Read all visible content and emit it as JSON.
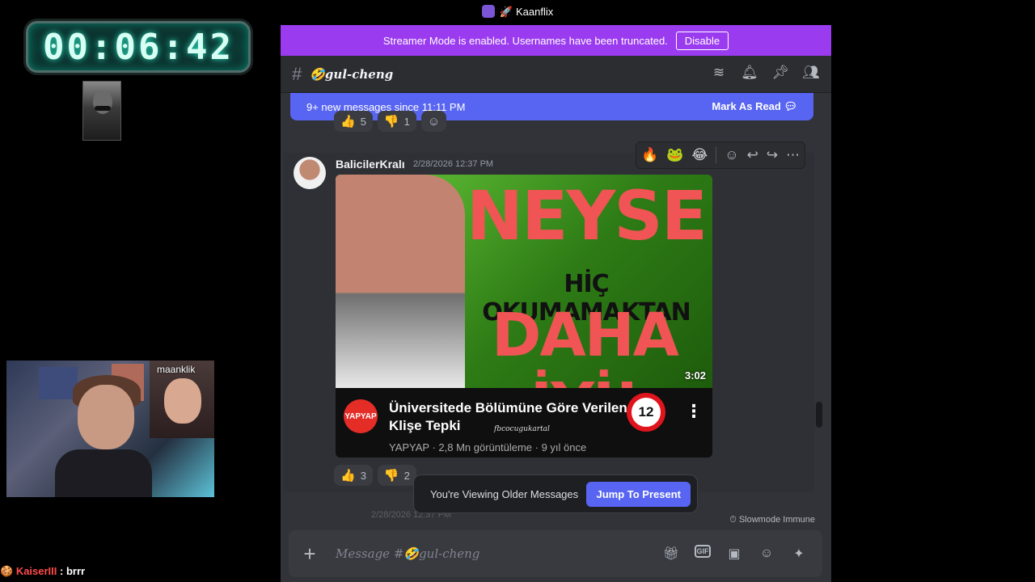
{
  "window": {
    "title": "Kaanflix"
  },
  "overlay": {
    "timer": "00:06:42",
    "webcam_name": "maanklik",
    "chat": {
      "user": "KaiserIII",
      "text": ": brrr"
    }
  },
  "streamer_bar": {
    "text": "Streamer Mode is enabled. Usernames have been truncated.",
    "button": "Disable"
  },
  "channel": {
    "name": "🤣gul-cheng"
  },
  "new_messages": {
    "text": "9+ new messages since 11:11 PM",
    "mark_read": "Mark As Read"
  },
  "prev_reactions": [
    {
      "emoji": "👍",
      "count": "5"
    },
    {
      "emoji": "👎",
      "count": "1"
    },
    {
      "emoji": "☺",
      "count": ""
    }
  ],
  "message": {
    "author": "BalicilerKralı",
    "timestamp": "2/28/2026 12:37 PM",
    "toolbar_emojis": [
      "🔥",
      "🐸",
      "😂"
    ],
    "embed": {
      "thumb_line1": "NEYSE",
      "thumb_line2": "HİÇ OKUMAMAKTAN",
      "thumb_line3": "DAHA İYİ!",
      "duration": "3:02",
      "channel_logo": "YAPYAP",
      "title": "Üniversitede Bölümüne Göre Verilen Klişe Tepki",
      "badge": "12",
      "watermark": "fbcocugukartal",
      "meta": "YAPYAP · 2,8 Mn görüntüleme · 9 yıl önce"
    },
    "reactions": [
      {
        "emoji": "👍",
        "count": "3"
      },
      {
        "emoji": "👎",
        "count": "2"
      }
    ]
  },
  "older_messages": {
    "text": "You're Viewing Older Messages",
    "button": "Jump To Present"
  },
  "next_stub": "2/28/2026 12:37 PM",
  "slowmode": "Slowmode Immune",
  "composer": {
    "placeholder": "Message #🤣gul-cheng"
  }
}
